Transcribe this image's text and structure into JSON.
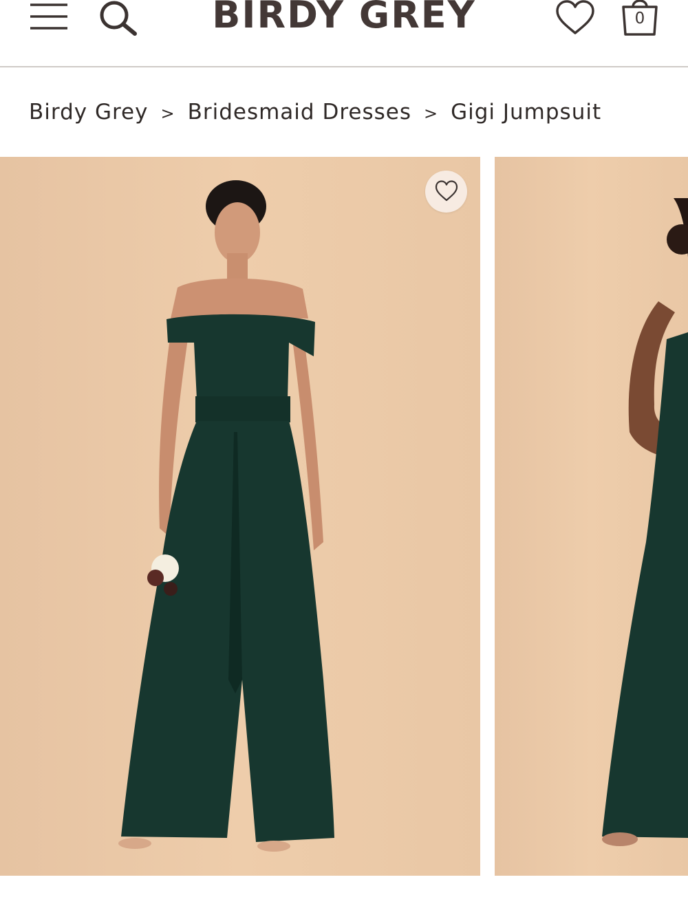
{
  "header": {
    "logo": "BIRDY GREY",
    "bag_count": "0",
    "icons": [
      "menu-icon",
      "search-icon",
      "heart-icon",
      "shopping-bag-icon"
    ]
  },
  "breadcrumb": {
    "items": [
      "Birdy Grey",
      "Bridesmaid Dresses",
      "Gigi Jumpsuit"
    ],
    "separator": ">"
  },
  "gallery": {
    "images": [
      {
        "subject": "model wearing dark green off-shoulder jumpsuit holding flowers"
      },
      {
        "subject": "model wearing dark green strapless dress"
      }
    ],
    "wishlist_icon": "heart-icon"
  },
  "colors": {
    "text": "#3b3331",
    "divider": "#cfcac7",
    "image_background": "#eccaa8",
    "garment": "#17372f",
    "wishlist_bg": "#f7ebe2"
  }
}
